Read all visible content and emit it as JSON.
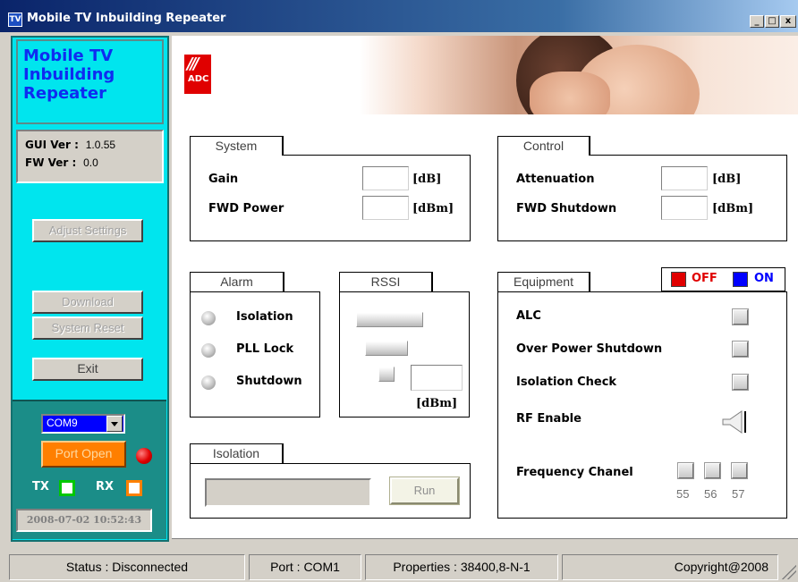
{
  "window": {
    "title": "Mobile TV Inbuilding Repeater",
    "controls": {
      "minimize": "_",
      "maximize": "□",
      "close": "x"
    }
  },
  "sidebar": {
    "app_title": "Mobile TV\nInbuilding\nRepeater",
    "gui_ver_label": "GUI Ver :",
    "gui_ver_value": "1.0.55",
    "fw_ver_label": "FW Ver :",
    "fw_ver_value": "0.0",
    "adjust_settings": "Adjust Settings",
    "download": "Download",
    "system_reset": "System Reset",
    "exit": "Exit",
    "com_port": "COM9",
    "port_open": "Port Open",
    "tx_label": "TX",
    "rx_label": "RX",
    "datetime": "2008-07-02  10:52:43"
  },
  "logo": {
    "slashes": "///",
    "text": "ADC"
  },
  "system": {
    "title": "System",
    "gain_label": "Gain",
    "gain_unit": "[dB]",
    "fwd_power_label": "FWD Power",
    "fwd_power_unit": "[dBm]"
  },
  "control": {
    "title": "Control",
    "attenuation_label": "Attenuation",
    "attenuation_unit": "[dB]",
    "fwd_shutdown_label": "FWD Shutdown",
    "fwd_shutdown_unit": "[dBm]"
  },
  "alarm": {
    "title": "Alarm",
    "items": [
      "Isolation",
      "PLL Lock",
      "Shutdown"
    ]
  },
  "rssi": {
    "title": "RSSI",
    "unit": "[dBm]"
  },
  "equipment": {
    "title": "Equipment",
    "legend_off": "OFF",
    "legend_on": "ON",
    "alc": "ALC",
    "over_power_shutdown": "Over Power Shutdown",
    "isolation_check": "Isolation Check",
    "rf_enable": "RF Enable",
    "frequency_channel": "Frequency Chanel",
    "channels": [
      "55",
      "56",
      "57"
    ]
  },
  "isolation": {
    "title": "Isolation",
    "run": "Run"
  },
  "status_bar": {
    "status": "Status : Disconnected",
    "port": "Port : COM1",
    "properties": "Properties : 38400,8-N-1",
    "copyright": "Copyright@2008"
  },
  "colors": {
    "sidebar_bg": "#00e5ee",
    "sidebar_bottom": "#1b8d88",
    "title_text": "#0f2cf0",
    "off": "#e00000",
    "on": "#0000ff",
    "port_open_btn": "#ff7f00"
  },
  "icons": {
    "app": "repeater-app-icon",
    "speaker": "speaker-icon",
    "led_red": "red-status-led",
    "led_grey": "grey-alarm-led"
  }
}
